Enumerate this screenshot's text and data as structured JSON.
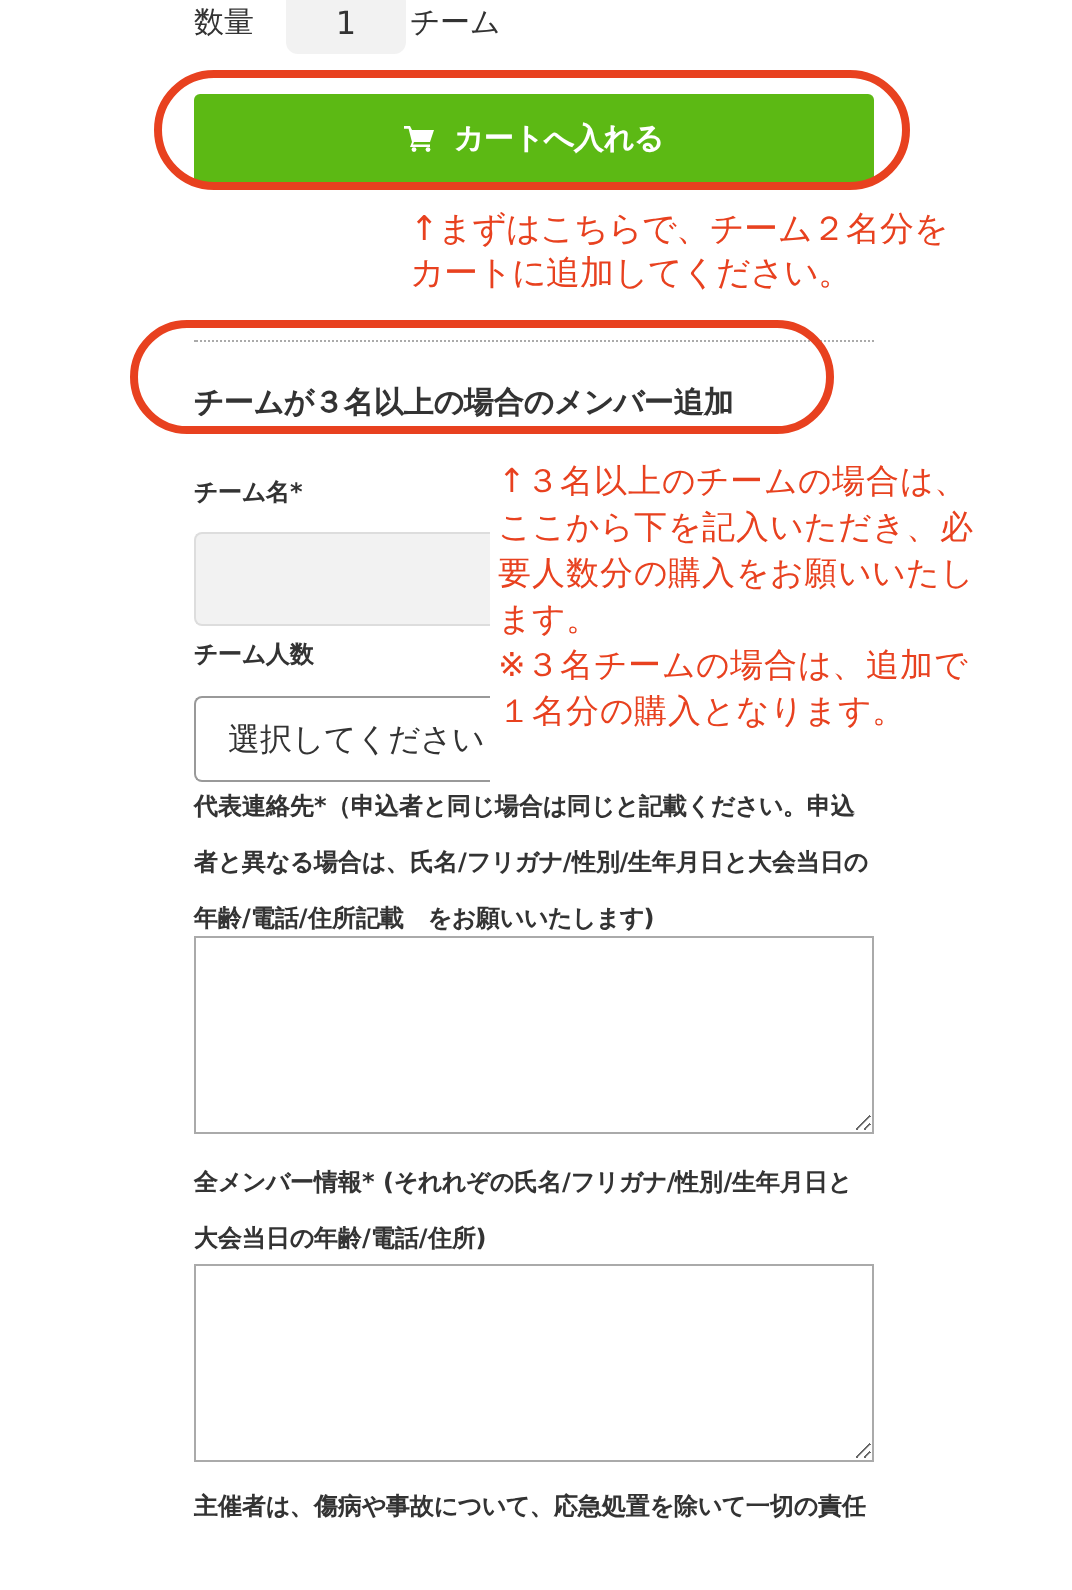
{
  "quantity": {
    "label": "数量",
    "value": "1",
    "unit": "チーム"
  },
  "cart_button": {
    "label": "カートへ入れる"
  },
  "annotations": [
    {
      "lines": [
        "↑まずはこちらで、チーム２名分を",
        "カートに追加してください。"
      ]
    },
    {
      "lines": [
        "↑３名以上のチームの場合は、",
        "ここから下を記入いただき、必",
        "要人数分の購入をお願いいたし",
        "ます。",
        "※３名チームの場合は、追加で",
        "１名分の購入となります。"
      ]
    }
  ],
  "section_heading": "チームが３名以上の場合のメンバー追加",
  "fields": [
    {
      "kind": "input",
      "label": "チーム名*"
    },
    {
      "kind": "select",
      "label": "チーム人数",
      "value": "選択してください"
    },
    {
      "kind": "textarea",
      "label": "代表連絡先*（申込者と同じ場合は同じと記載ください。申込者と異なる場合は、氏名/フリガナ/性別/生年月日と大会当日の年齢/電話/住所記載　をお願いいたします)"
    },
    {
      "kind": "textarea",
      "label": "全メンバー情報* (それれぞの氏名/フリガナ/性別/生年月日と大会当日の年齢/電話/住所)"
    },
    {
      "kind": "text",
      "label": "主催者は、傷病や事故について、応急処置を除いて一切の責任"
    }
  ]
}
